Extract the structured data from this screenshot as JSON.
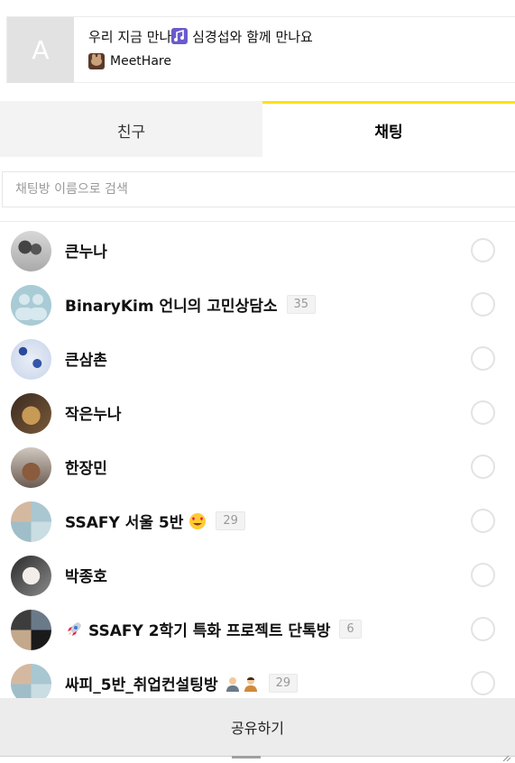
{
  "share_card": {
    "thumb_letter": "A",
    "title": "우리 지금 만나",
    "title_suffix": "심경섭와 함께 만나요",
    "source_name": "MeetHare"
  },
  "tabs": [
    {
      "label": "친구",
      "active": false
    },
    {
      "label": "채팅",
      "active": true
    }
  ],
  "search": {
    "placeholder": "채팅방 이름으로 검색",
    "value": ""
  },
  "chats": [
    {
      "name": "큰누나",
      "count": "",
      "avatar": "photo1"
    },
    {
      "name": "BinaryKim 언니의 고민상담소",
      "count": "35",
      "avatar": "default"
    },
    {
      "name": "큰삼촌",
      "count": "",
      "avatar": "blue"
    },
    {
      "name": "작은누나",
      "count": "",
      "avatar": "dog"
    },
    {
      "name": "한장민",
      "count": "",
      "avatar": "sleep"
    },
    {
      "name": "SSAFY 서울 5반",
      "count": "29",
      "avatar": "mix",
      "emoji": "heart-eyes-icon"
    },
    {
      "name": "박종호",
      "count": "",
      "avatar": "cat"
    },
    {
      "name": "SSAFY 2학기 특화 프로젝트 단톡방",
      "count": "6",
      "avatar": "quad",
      "emoji_prefix": "rocket-icon"
    },
    {
      "name": "싸피_5반_취업컨설팅방",
      "count": "29",
      "avatar": "mix",
      "emoji": "people-icon"
    }
  ],
  "share_button": {
    "label": "공유하기"
  },
  "colors": {
    "accent": "#ffe200",
    "tab_inactive_bg": "#f3f3f3",
    "button_bg": "#ececec"
  }
}
